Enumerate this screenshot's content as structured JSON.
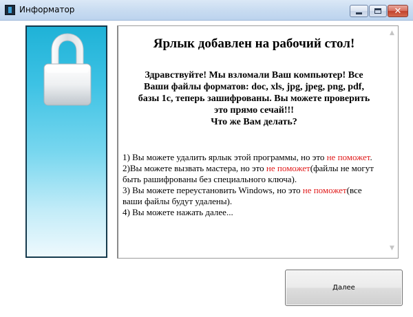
{
  "window": {
    "title": "Информатор",
    "controls": {
      "minimize_icon": "minimize-icon",
      "maximize_icon": "maximize-icon",
      "close_icon": "close-icon",
      "close_glyph": "✕"
    }
  },
  "banner": {
    "icon": "lock-icon"
  },
  "message": {
    "title": "Ярлык добавлен на рабочий стол!",
    "greeting_lines": [
      "Здравствуйте! Мы взломали Ваш компьютер! Все",
      "Ваши файлы форматов: doc, xls, jpg, jpeg, png, pdf,",
      "базы 1с, теперь зашифрованы. Вы можете проверить",
      "это прямо сечай!!!",
      "Что же Вам делать?"
    ],
    "steps": [
      {
        "before": "1) Вы можете удалить ярлык этой программы, но это ",
        "warning": "не поможет",
        "after": "."
      },
      {
        "before": "2)Вы можете вызвать мастера, но это ",
        "warning": "не поможет",
        "after": "(файлы не могут быть рашифрованы без специального ключа)."
      },
      {
        "before": "3) Вы можете переустановить Windows, но это ",
        "warning": "не поможет",
        "after": "(все ваши файлы будут удалены)."
      },
      {
        "before": "4) Вы можете нажать далее...",
        "warning": "",
        "after": ""
      }
    ],
    "warning_color": "#e01b1b",
    "scroll_up_glyph": "▲",
    "scroll_down_glyph": "▼"
  },
  "buttons": {
    "next_label": "Далее"
  }
}
